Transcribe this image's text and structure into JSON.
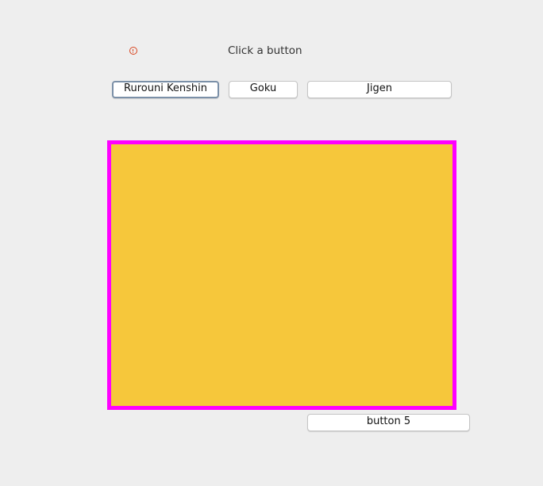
{
  "header": {
    "icon": "warning-circle-icon",
    "status_text": "Click a button"
  },
  "buttons": [
    {
      "label": "Rurouni Kenshin"
    },
    {
      "label": "Goku"
    },
    {
      "label": "Jigen"
    },
    {
      "label": "button 5"
    }
  ],
  "panel": {
    "fill_color": "#f6c73b",
    "border_color": "#ff00ff"
  }
}
